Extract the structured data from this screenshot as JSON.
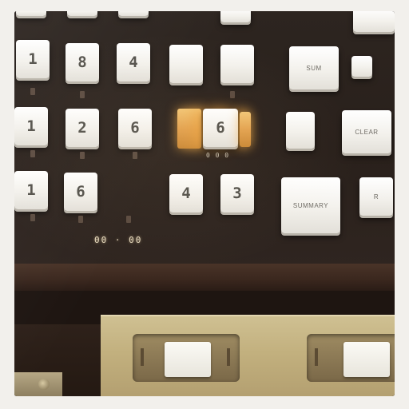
{
  "keys": {
    "r1": [
      "1",
      "8",
      "4",
      "",
      "",
      "",
      ""
    ],
    "r2": [
      "1",
      "2",
      "6",
      "6",
      "",
      "",
      ""
    ],
    "r3": [
      "1",
      "6",
      "4",
      "3",
      "",
      ""
    ]
  },
  "key_small_labels": {
    "r1k6": "SUM",
    "r2k6": "CLEAR",
    "r3k5": "SUMMARY",
    "r3k6": "R"
  },
  "display": {
    "readout": "00 · 00"
  },
  "marks": {
    "under_lit": "0 0 0"
  },
  "colors": {
    "panel": "#2a211c",
    "key": "#f3f1ec",
    "lamp": "#e3a24f",
    "base": "#c2b07e"
  }
}
